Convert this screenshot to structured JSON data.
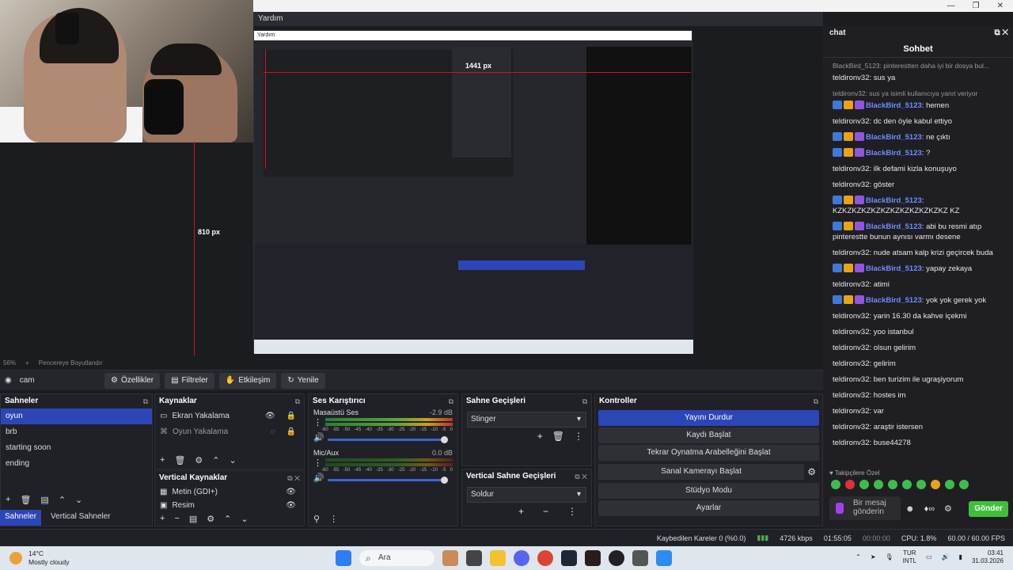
{
  "window": {
    "projector_title": "Yardım",
    "controls": [
      "—",
      "❐",
      "✕"
    ]
  },
  "preview": {
    "nested_px_1": "1441 px",
    "nested_px_2": "810 px",
    "footer_zoom": "56%",
    "footer_plus": "+",
    "footer_resize": "Pencereye Boyutlandır"
  },
  "source_toolbar": {
    "name": "cam",
    "properties": "Özellikler",
    "filters": "Filtreler",
    "interact": "Etkileşim",
    "refresh": "Yenile"
  },
  "scenes": {
    "title": "Sahneler",
    "items": [
      "oyun",
      "brb",
      "starting soon",
      "ending"
    ],
    "tab_scenes": "Sahneler",
    "tab_vertical": "Vertical Sahneler"
  },
  "sources": {
    "title": "Kaynaklar",
    "items": [
      "Ekran Yakalama",
      "Oyun Yakalama"
    ]
  },
  "vertical_sources": {
    "title": "Vertical Kaynaklar",
    "items": [
      "Metin (GDI+)",
      "Resim"
    ]
  },
  "mixer": {
    "title": "Ses Karıştırıcı",
    "channels": [
      {
        "name": "Masaüstü Ses",
        "db": "-2.9 dB"
      },
      {
        "name": "Mic/Aux",
        "db": "0.0 dB"
      }
    ],
    "scale": [
      "-60",
      "-55",
      "-50",
      "-45",
      "-40",
      "-35",
      "-30",
      "-25",
      "-20",
      "-15",
      "-10",
      "-5",
      "0"
    ]
  },
  "transitions": {
    "title": "Sahne Geçişleri",
    "value": "Stinger"
  },
  "vertical_transitions": {
    "title": "Vertical Sahne Geçişleri",
    "value": "Soldur"
  },
  "controls": {
    "title": "Kontroller",
    "stop_stream": "Yayını Durdur",
    "start_record": "Kaydı Başlat",
    "replay": "Tekrar Oynatma Arabelleğini Başlat",
    "virtual_cam": "Sanal Kamerayı Başlat",
    "studio": "Stüdyo Modu",
    "settings": "Ayarlar"
  },
  "status": {
    "dropped": "Kaybedilen Kareler 0 (%0.0)",
    "bitrate": "4726 kbps",
    "stream_time": "01:55:05",
    "rec_time": "00:00:00",
    "cpu": "CPU: 1.8%",
    "fps": "60.00 / 60.00 FPS"
  },
  "chat": {
    "dock_title": "chat",
    "title": "Sohbet",
    "messages": [
      {
        "reply": "BlackBird_5123: pinterestten daha iyi bir dosya bul...",
        "user": "teldironv32",
        "text": "sus ya",
        "style": "plain"
      },
      {
        "reply": "teldironv32: sus ya isimli kullanıcıya yanıt veriyor",
        "user": "BlackBird_5123",
        "text": "hemen",
        "style": "badged"
      },
      {
        "user": "teldironv32",
        "text": "dc den öyle kabul ettiyo",
        "style": "plain"
      },
      {
        "user": "BlackBird_5123",
        "text": "ne çıktı",
        "style": "badged"
      },
      {
        "user": "BlackBird_5123",
        "text": "?",
        "style": "badged"
      },
      {
        "user": "teldironv32",
        "text": "ilk defami kizla konuşuyo",
        "style": "plain"
      },
      {
        "user": "teldironv32",
        "text": "göster",
        "style": "plain"
      },
      {
        "user": "BlackBird_5123",
        "text": "KZKZKZKZKZKZKZKZKZKZKZKZ KZ",
        "style": "badged"
      },
      {
        "user": "BlackBird_5123",
        "text": "abi bu resmi atıp pinterestte bunun aynısı varmı desene",
        "style": "badged"
      },
      {
        "user": "teldironv32",
        "text": "nude atsam kalp krizi geçircek buda",
        "style": "plain"
      },
      {
        "user": "BlackBird_5123",
        "text": "yapay zekaya",
        "style": "badged"
      },
      {
        "user": "teldironv32",
        "text": "atimi",
        "style": "plain"
      },
      {
        "user": "BlackBird_5123",
        "text": "yok yok gerek yok",
        "style": "badged"
      },
      {
        "user": "teldironv32",
        "text": "yarin 16.30 da kahve içekmi",
        "style": "plain"
      },
      {
        "user": "teldironv32",
        "text": "yoo istanbul",
        "style": "plain"
      },
      {
        "user": "teldironv32",
        "text": "olsun gelirim",
        "style": "plain"
      },
      {
        "user": "teldironv32",
        "text": "gelirim",
        "style": "plain"
      },
      {
        "user": "teldironv32",
        "text": "ben turizim ile ugraşiyorum",
        "style": "plain"
      },
      {
        "user": "teldironv32",
        "text": "hostes im",
        "style": "plain"
      },
      {
        "user": "teldironv32",
        "text": "var",
        "style": "plain"
      },
      {
        "user": "teldironv32",
        "text": "araştir istersen",
        "style": "plain"
      },
      {
        "user": "teldironv32",
        "text": "buse44278",
        "style": "plain"
      }
    ],
    "followers": "Takipçilere Özel",
    "input_placeholder": "Bir mesaj gönderin",
    "send": "Gönder",
    "user_color": "#6f8cff",
    "send_color": "#3fbf3a"
  },
  "taskbar": {
    "temp": "14°C",
    "weather": "Mostly cloudy",
    "search": "Ara",
    "lang1": "TUR",
    "lang2": "INTL",
    "time": "03:41",
    "date": "31.03.2026"
  },
  "accent": "#2c46b8"
}
